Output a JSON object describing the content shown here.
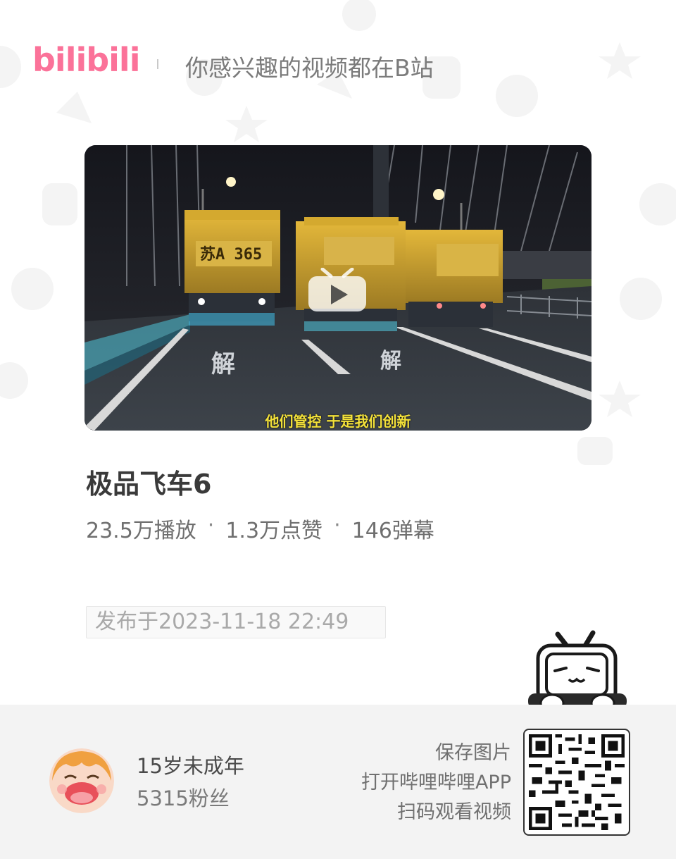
{
  "header": {
    "logo_text": "bilibili",
    "slogan": "你感兴趣的视频都在B站"
  },
  "video": {
    "subtitle": "他们管控 于是我们创新",
    "plate_text": "苏A 365",
    "title": "极品飞车6",
    "stats": {
      "plays": "23.5万播放",
      "likes": "1.3万点赞",
      "danmaku": "146弹幕",
      "separator": "·"
    },
    "publish_date": "发布于2023-11-18 22:49"
  },
  "uploader": {
    "name": "15岁未成年",
    "fans": "5315粉丝"
  },
  "share": {
    "line1": "保存图片",
    "line2": "打开哔哩哔哩APP",
    "line3": "扫码观看视频"
  },
  "colors": {
    "brand": "#fb7299",
    "footer_bg": "#f3f3f3"
  },
  "icons": [
    "bilibili-logo",
    "play-icon",
    "avatar",
    "qr-code",
    "tv-mascot-icon"
  ]
}
